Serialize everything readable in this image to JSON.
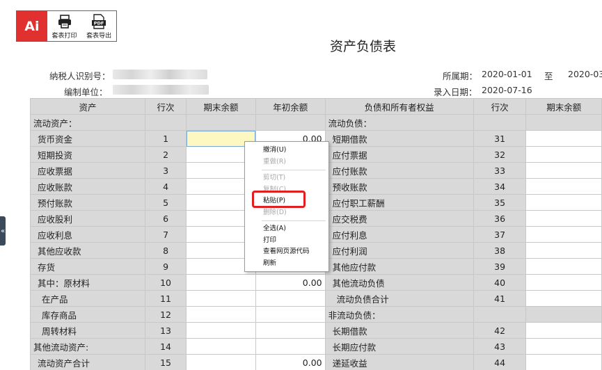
{
  "toolbar": {
    "logo_text": "Ai",
    "print_label": "套表打印",
    "export_label": "套表导出",
    "pdf_badge": "PDF"
  },
  "title": "资产负债表",
  "meta": {
    "taxpayer_id_label": "纳税人识别号：",
    "company_label": "编制单位：",
    "period_label": "所属期：",
    "period_start": "2020-01-01",
    "period_to": "至",
    "period_end": "2020-03",
    "entry_date_label": "录入日期：",
    "entry_date": "2020-07-16"
  },
  "table": {
    "headers": [
      "资产",
      "行次",
      "期末余额",
      "年初余额",
      "负债和所有者权益",
      "行次",
      "期末余额"
    ],
    "rows": [
      {
        "a": "流动资产：",
        "an": "",
        "ae": "",
        "ab": "",
        "l": "流动负债：",
        "ln": "",
        "le": ""
      },
      {
        "a": "货币资金",
        "an": "1",
        "ae": "",
        "ab": "0.00",
        "l": "短期借款",
        "ln": "31",
        "le": ""
      },
      {
        "a": "短期投资",
        "an": "2",
        "ae": "",
        "ab": "",
        "l": "应付票据",
        "ln": "32",
        "le": ""
      },
      {
        "a": "应收票据",
        "an": "3",
        "ae": "",
        "ab": "",
        "l": "应付账款",
        "ln": "33",
        "le": ""
      },
      {
        "a": "应收账款",
        "an": "4",
        "ae": "",
        "ab": "",
        "l": "预收账款",
        "ln": "34",
        "le": ""
      },
      {
        "a": "预付账款",
        "an": "5",
        "ae": "",
        "ab": "",
        "l": "应付职工薪酬",
        "ln": "35",
        "le": ""
      },
      {
        "a": "应收股利",
        "an": "6",
        "ae": "",
        "ab": "",
        "l": "应交税费",
        "ln": "36",
        "le": ""
      },
      {
        "a": "应收利息",
        "an": "7",
        "ae": "",
        "ab": "",
        "l": "应付利息",
        "ln": "37",
        "le": ""
      },
      {
        "a": "其他应收款",
        "an": "8",
        "ae": "",
        "ab": "",
        "l": "应付利润",
        "ln": "38",
        "le": ""
      },
      {
        "a": "存货",
        "an": "9",
        "ae": "",
        "ab": "",
        "l": "其他应付款",
        "ln": "39",
        "le": ""
      },
      {
        "a": "其中：原材料",
        "an": "10",
        "ae": "",
        "ab": "0.00",
        "l": "其他流动负债",
        "ln": "40",
        "le": ""
      },
      {
        "a": "在产品",
        "an": "11",
        "ae": "",
        "ab": "",
        "l": "流动负债合计",
        "ln": "41",
        "le": ""
      },
      {
        "a": "库存商品",
        "an": "12",
        "ae": "",
        "ab": "",
        "l": "非流动负债：",
        "ln": "",
        "le": ""
      },
      {
        "a": "周转材料",
        "an": "13",
        "ae": "",
        "ab": "",
        "l": "长期借款",
        "ln": "42",
        "le": ""
      },
      {
        "a": "其他流动资产:",
        "an": "14",
        "ae": "",
        "ab": "",
        "l": "长期应付款",
        "ln": "43",
        "le": ""
      },
      {
        "a": "流动资产合计",
        "an": "15",
        "ae": "",
        "ab": "0.00",
        "l": "递延收益",
        "ln": "44",
        "le": ""
      }
    ]
  },
  "context_menu": {
    "items": [
      {
        "label": "撤消(U)",
        "disabled": false
      },
      {
        "label": "重做(R)",
        "disabled": true
      },
      {
        "sep": true
      },
      {
        "label": "剪切(T)",
        "disabled": true
      },
      {
        "label": "复制(C)",
        "disabled": true
      },
      {
        "label": "粘贴(P)",
        "disabled": false
      },
      {
        "label": "删除(D)",
        "disabled": true
      },
      {
        "sep": true
      },
      {
        "label": "全选(A)",
        "disabled": false
      },
      {
        "label": "打印",
        "disabled": false
      },
      {
        "label": "查看网页源代码",
        "disabled": false
      },
      {
        "label": "刷新",
        "disabled": false
      }
    ]
  },
  "sidetab_glyph": "«",
  "colors": {
    "accent": "#e03030",
    "header_bg": "#d9d9d9",
    "selected_cell": "#fdf7c2"
  }
}
